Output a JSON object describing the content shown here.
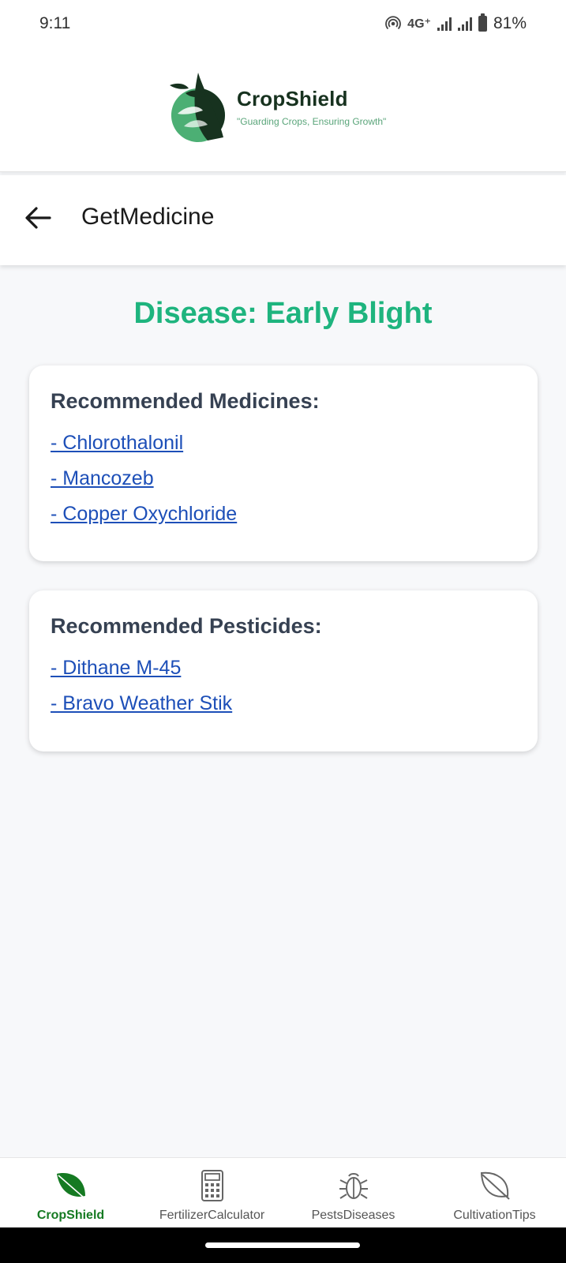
{
  "status_bar": {
    "time": "9:11",
    "network": "4G⁺",
    "battery": "81%",
    "icons": [
      "hotspot-icon",
      "signal-icon",
      "signal-icon",
      "battery-icon"
    ]
  },
  "brand": {
    "name": "CropShield",
    "tagline": "\"Guarding Crops, Ensuring Growth\"",
    "colors": {
      "dark": "#17321f",
      "accent": "#4caf74"
    }
  },
  "app_bar": {
    "title": "GetMedicine",
    "back_icon": "arrow-left-icon"
  },
  "main": {
    "disease_title": "Disease: Early Blight",
    "title_color": "#1eb47e",
    "medicines": {
      "heading": "Recommended Medicines:",
      "items": [
        "- Chlorothalonil",
        "- Mancozeb",
        "- Copper Oxychloride"
      ]
    },
    "pesticides": {
      "heading": "Recommended Pesticides:",
      "items": [
        "- Dithane M-45",
        "- Bravo Weather Stik"
      ]
    },
    "link_color": "#1d4fb8"
  },
  "bottom_nav": {
    "active_color": "#157a22",
    "items": [
      {
        "label": "CropShield",
        "icon": "leaf-filled-icon",
        "active": true
      },
      {
        "label": "FertilizerCalculator",
        "icon": "calculator-icon",
        "active": false
      },
      {
        "label": "PestsDiseases",
        "icon": "bug-icon",
        "active": false
      },
      {
        "label": "CultivationTips",
        "icon": "leaf-outline-icon",
        "active": false
      }
    ]
  }
}
